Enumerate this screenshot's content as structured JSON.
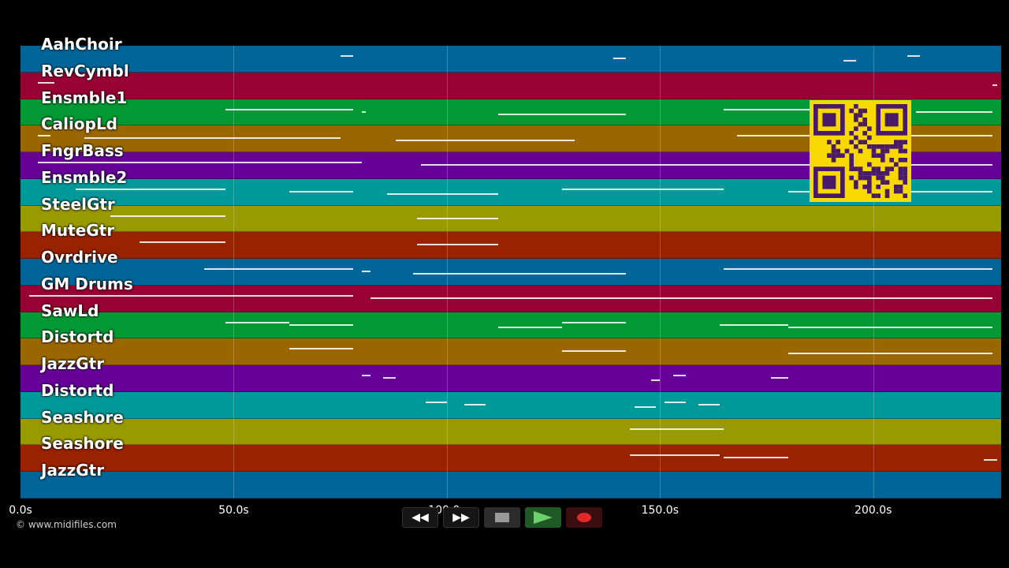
{
  "tracks": [
    "AahChoir",
    "RevCymbl",
    "Ensmble1",
    "CaliopLd",
    "FngrBass",
    "Ensmble2",
    "SteelGtr",
    "MuteGtr",
    "Ovrdrive",
    "GM Drums",
    "SawLd",
    "Distortd",
    "JazzGtr",
    "Distortd",
    "Seashore",
    "Seashore",
    "JazzGtr"
  ],
  "lane_colors": [
    "#006699",
    "#990033",
    "#009933",
    "#996600",
    "#660099",
    "#009999",
    "#999900",
    "#992200"
  ],
  "time_axis": {
    "ticks": [
      "0.0s",
      "50.0s",
      "100.0s",
      "150.0s",
      "200.0s"
    ],
    "tick_seconds": [
      0,
      50,
      100,
      150,
      200
    ],
    "max_seconds": 230
  },
  "copyright": "© www.midifiles.com",
  "transport": {
    "rewind_icon": "rewind-icon",
    "forward_icon": "fast-forward-icon",
    "stop_icon": "stop-icon",
    "play_icon": "play-icon",
    "record_icon": "record-icon"
  },
  "qr_icon": "qr-code-icon",
  "notes": [
    [
      [
        75,
        78
      ],
      [
        139,
        142
      ],
      [
        193,
        196
      ],
      [
        208,
        211
      ]
    ],
    [
      [
        4,
        8
      ],
      [
        228,
        229
      ]
    ],
    [
      [
        48,
        78
      ],
      [
        80,
        81
      ],
      [
        112,
        142
      ],
      [
        165,
        200
      ],
      [
        210,
        228
      ]
    ],
    [
      [
        4,
        7
      ],
      [
        15,
        75
      ],
      [
        88,
        130
      ],
      [
        168,
        228
      ]
    ],
    [
      [
        4,
        80
      ],
      [
        94,
        228
      ]
    ],
    [
      [
        13,
        48
      ],
      [
        63,
        78
      ],
      [
        86,
        112
      ],
      [
        127,
        165
      ],
      [
        180,
        228
      ]
    ],
    [
      [
        21,
        48
      ],
      [
        93,
        112
      ]
    ],
    [
      [
        28,
        48
      ],
      [
        93,
        112
      ]
    ],
    [
      [
        43,
        78
      ],
      [
        80,
        82
      ],
      [
        92,
        142
      ],
      [
        165,
        228
      ]
    ],
    [
      [
        2,
        78
      ],
      [
        82,
        228
      ]
    ],
    [
      [
        48,
        63
      ],
      [
        63,
        78
      ],
      [
        112,
        127
      ],
      [
        127,
        142
      ],
      [
        164,
        180
      ],
      [
        180,
        228
      ]
    ],
    [
      [
        63,
        78
      ],
      [
        127,
        142
      ],
      [
        180,
        228
      ]
    ],
    [
      [
        80,
        82
      ],
      [
        85,
        88
      ],
      [
        148,
        150
      ],
      [
        153,
        156
      ],
      [
        176,
        180
      ]
    ],
    [
      [
        95,
        100
      ],
      [
        104,
        109
      ],
      [
        144,
        149
      ],
      [
        151,
        156
      ],
      [
        159,
        164
      ]
    ],
    [
      [
        143,
        165
      ]
    ],
    [
      [
        143,
        164
      ],
      [
        165,
        180
      ],
      [
        226,
        229
      ]
    ],
    []
  ]
}
